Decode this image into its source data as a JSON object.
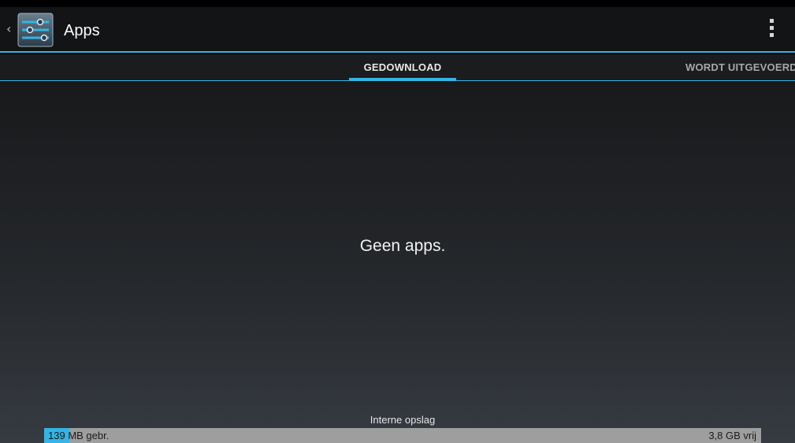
{
  "action_bar": {
    "title": "Apps",
    "up_icon": "chevron-left-icon",
    "app_icon": "settings-sliders-icon",
    "overflow_icon": "overflow-menu-icon"
  },
  "tabs": [
    {
      "label": "GEDOWNLOAD",
      "selected": true
    },
    {
      "label": "WORDT UITGEVOERD",
      "selected": false
    }
  ],
  "content": {
    "empty_message": "Geen apps."
  },
  "storage": {
    "label": "Interne opslag",
    "used_value": "139",
    "used_suffix": " MB gebr.",
    "free": "3,8 GB vrij"
  },
  "colors": {
    "accent": "#33b5e5",
    "action_bar_bg": "#131416",
    "storage_bar_bg": "#9e9e9e"
  }
}
